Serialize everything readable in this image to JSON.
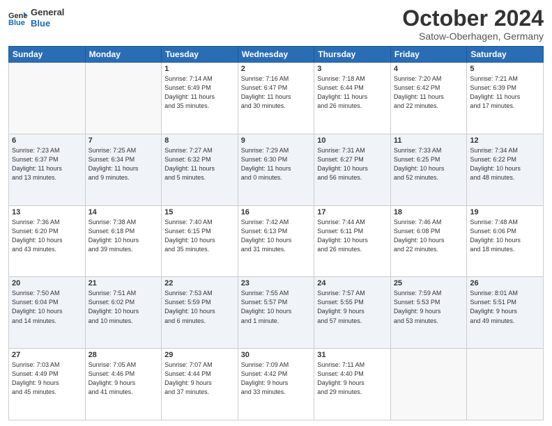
{
  "header": {
    "logo_line1": "General",
    "logo_line2": "Blue",
    "month": "October 2024",
    "location": "Satow-Oberhagen, Germany"
  },
  "days_of_week": [
    "Sunday",
    "Monday",
    "Tuesday",
    "Wednesday",
    "Thursday",
    "Friday",
    "Saturday"
  ],
  "weeks": [
    [
      {
        "day": "",
        "info": ""
      },
      {
        "day": "",
        "info": ""
      },
      {
        "day": "1",
        "info": "Sunrise: 7:14 AM\nSunset: 6:49 PM\nDaylight: 11 hours\nand 35 minutes."
      },
      {
        "day": "2",
        "info": "Sunrise: 7:16 AM\nSunset: 6:47 PM\nDaylight: 11 hours\nand 30 minutes."
      },
      {
        "day": "3",
        "info": "Sunrise: 7:18 AM\nSunset: 6:44 PM\nDaylight: 11 hours\nand 26 minutes."
      },
      {
        "day": "4",
        "info": "Sunrise: 7:20 AM\nSunset: 6:42 PM\nDaylight: 11 hours\nand 22 minutes."
      },
      {
        "day": "5",
        "info": "Sunrise: 7:21 AM\nSunset: 6:39 PM\nDaylight: 11 hours\nand 17 minutes."
      }
    ],
    [
      {
        "day": "6",
        "info": "Sunrise: 7:23 AM\nSunset: 6:37 PM\nDaylight: 11 hours\nand 13 minutes."
      },
      {
        "day": "7",
        "info": "Sunrise: 7:25 AM\nSunset: 6:34 PM\nDaylight: 11 hours\nand 9 minutes."
      },
      {
        "day": "8",
        "info": "Sunrise: 7:27 AM\nSunset: 6:32 PM\nDaylight: 11 hours\nand 5 minutes."
      },
      {
        "day": "9",
        "info": "Sunrise: 7:29 AM\nSunset: 6:30 PM\nDaylight: 11 hours\nand 0 minutes."
      },
      {
        "day": "10",
        "info": "Sunrise: 7:31 AM\nSunset: 6:27 PM\nDaylight: 10 hours\nand 56 minutes."
      },
      {
        "day": "11",
        "info": "Sunrise: 7:33 AM\nSunset: 6:25 PM\nDaylight: 10 hours\nand 52 minutes."
      },
      {
        "day": "12",
        "info": "Sunrise: 7:34 AM\nSunset: 6:22 PM\nDaylight: 10 hours\nand 48 minutes."
      }
    ],
    [
      {
        "day": "13",
        "info": "Sunrise: 7:36 AM\nSunset: 6:20 PM\nDaylight: 10 hours\nand 43 minutes."
      },
      {
        "day": "14",
        "info": "Sunrise: 7:38 AM\nSunset: 6:18 PM\nDaylight: 10 hours\nand 39 minutes."
      },
      {
        "day": "15",
        "info": "Sunrise: 7:40 AM\nSunset: 6:15 PM\nDaylight: 10 hours\nand 35 minutes."
      },
      {
        "day": "16",
        "info": "Sunrise: 7:42 AM\nSunset: 6:13 PM\nDaylight: 10 hours\nand 31 minutes."
      },
      {
        "day": "17",
        "info": "Sunrise: 7:44 AM\nSunset: 6:11 PM\nDaylight: 10 hours\nand 26 minutes."
      },
      {
        "day": "18",
        "info": "Sunrise: 7:46 AM\nSunset: 6:08 PM\nDaylight: 10 hours\nand 22 minutes."
      },
      {
        "day": "19",
        "info": "Sunrise: 7:48 AM\nSunset: 6:06 PM\nDaylight: 10 hours\nand 18 minutes."
      }
    ],
    [
      {
        "day": "20",
        "info": "Sunrise: 7:50 AM\nSunset: 6:04 PM\nDaylight: 10 hours\nand 14 minutes."
      },
      {
        "day": "21",
        "info": "Sunrise: 7:51 AM\nSunset: 6:02 PM\nDaylight: 10 hours\nand 10 minutes."
      },
      {
        "day": "22",
        "info": "Sunrise: 7:53 AM\nSunset: 5:59 PM\nDaylight: 10 hours\nand 6 minutes."
      },
      {
        "day": "23",
        "info": "Sunrise: 7:55 AM\nSunset: 5:57 PM\nDaylight: 10 hours\nand 1 minute."
      },
      {
        "day": "24",
        "info": "Sunrise: 7:57 AM\nSunset: 5:55 PM\nDaylight: 9 hours\nand 57 minutes."
      },
      {
        "day": "25",
        "info": "Sunrise: 7:59 AM\nSunset: 5:53 PM\nDaylight: 9 hours\nand 53 minutes."
      },
      {
        "day": "26",
        "info": "Sunrise: 8:01 AM\nSunset: 5:51 PM\nDaylight: 9 hours\nand 49 minutes."
      }
    ],
    [
      {
        "day": "27",
        "info": "Sunrise: 7:03 AM\nSunset: 4:49 PM\nDaylight: 9 hours\nand 45 minutes."
      },
      {
        "day": "28",
        "info": "Sunrise: 7:05 AM\nSunset: 4:46 PM\nDaylight: 9 hours\nand 41 minutes."
      },
      {
        "day": "29",
        "info": "Sunrise: 7:07 AM\nSunset: 4:44 PM\nDaylight: 9 hours\nand 37 minutes."
      },
      {
        "day": "30",
        "info": "Sunrise: 7:09 AM\nSunset: 4:42 PM\nDaylight: 9 hours\nand 33 minutes."
      },
      {
        "day": "31",
        "info": "Sunrise: 7:11 AM\nSunset: 4:40 PM\nDaylight: 9 hours\nand 29 minutes."
      },
      {
        "day": "",
        "info": ""
      },
      {
        "day": "",
        "info": ""
      }
    ]
  ]
}
